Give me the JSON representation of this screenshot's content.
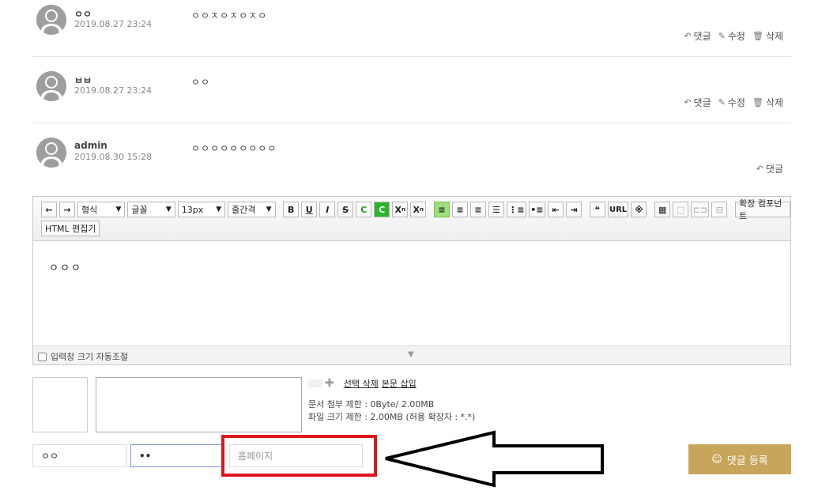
{
  "comments": [
    {
      "author": "ㅇㅇ",
      "date": "2019.08.27 23:24",
      "body": "ㅇㅇㅈㅇㅈㅇㅈㅇ",
      "actions": [
        "댓글",
        "수정",
        "삭제"
      ]
    },
    {
      "author": "ㅂㅂ",
      "date": "2019.08.27 23:24",
      "body": "ㅇㅇ",
      "actions": [
        "댓글",
        "수정",
        "삭제"
      ]
    },
    {
      "author": "admin",
      "date": "2019.08.30 15:28",
      "body": "ㅇㅇㅇㅇㅇㅇㅇㅇㅇ",
      "actions": [
        "댓글"
      ]
    }
  ],
  "editor": {
    "toolbar": {
      "format_label": "형식",
      "font_label": "글꼴",
      "size_label": "13px",
      "line_height_label": "줄간격",
      "url_label": "URL",
      "extension_label": "확장 컴포넌트",
      "html_editor_label": "HTML 편집기"
    },
    "content": "ㅇㅇㅇ",
    "auto_resize_label": "입력창 크기 자동조절"
  },
  "attachments": {
    "delete_selected": "선택 삭제",
    "insert_body": "본문 삽입",
    "doc_limit": "문서 첨부 제한 : 0Byte/ 2.00MB",
    "file_limit": "파일 크기 제한 : 2.00MB (허용 확장자 : *.*)"
  },
  "form": {
    "name_value": "ㅇㅇ",
    "password_value": "••",
    "homepage_placeholder": "홈페이지",
    "submit_label": "댓글 등록"
  },
  "colors": {
    "submit_bg": "#c7a55b",
    "highlight_box": "#e0141e"
  }
}
